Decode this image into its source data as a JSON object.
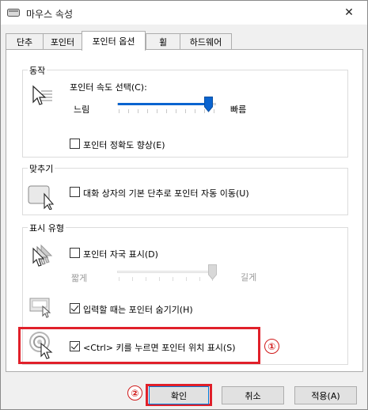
{
  "window": {
    "title": "마우스 속성",
    "close_glyph": "✕"
  },
  "tabs": [
    {
      "label": "단추",
      "active": false
    },
    {
      "label": "포인터",
      "active": false
    },
    {
      "label": "포인터 옵션",
      "active": true
    },
    {
      "label": "휠",
      "active": false
    },
    {
      "label": "하드웨어",
      "active": false
    }
  ],
  "motion": {
    "group_label": "동작",
    "speed_label": "포인터 속도 선택(C):",
    "slow_label": "느림",
    "fast_label": "빠름",
    "speed_level": 0.92,
    "precision_label": "포인터 정확도 향상(E)",
    "precision_checked": false
  },
  "snap": {
    "group_label": "맞추기",
    "snap_label": "대화 상자의 기본 단추로 포인터 자동 이동(U)",
    "snap_checked": false
  },
  "visibility": {
    "group_label": "표시 유형",
    "trails_label": "포인터 자국 표시(D)",
    "trails_checked": false,
    "short_label": "짧게",
    "long_label": "길게",
    "trails_level": 1.0,
    "hide_label": "입력할 때는 포인터 숨기기(H)",
    "hide_checked": true,
    "ctrl_label": "<Ctrl> 키를 누르면 포인터 위치 표시(S)",
    "ctrl_checked": true
  },
  "annotations": {
    "marker1": "①",
    "marker2": "②",
    "highlight_color": "#e0202a"
  },
  "buttons": {
    "ok_label": "확인",
    "cancel_label": "취소",
    "apply_label": "적용(A)"
  },
  "colors": {
    "accent": "#0a64d0",
    "panel_bg": "#ffffff",
    "window_bg": "#f0f0f0"
  }
}
